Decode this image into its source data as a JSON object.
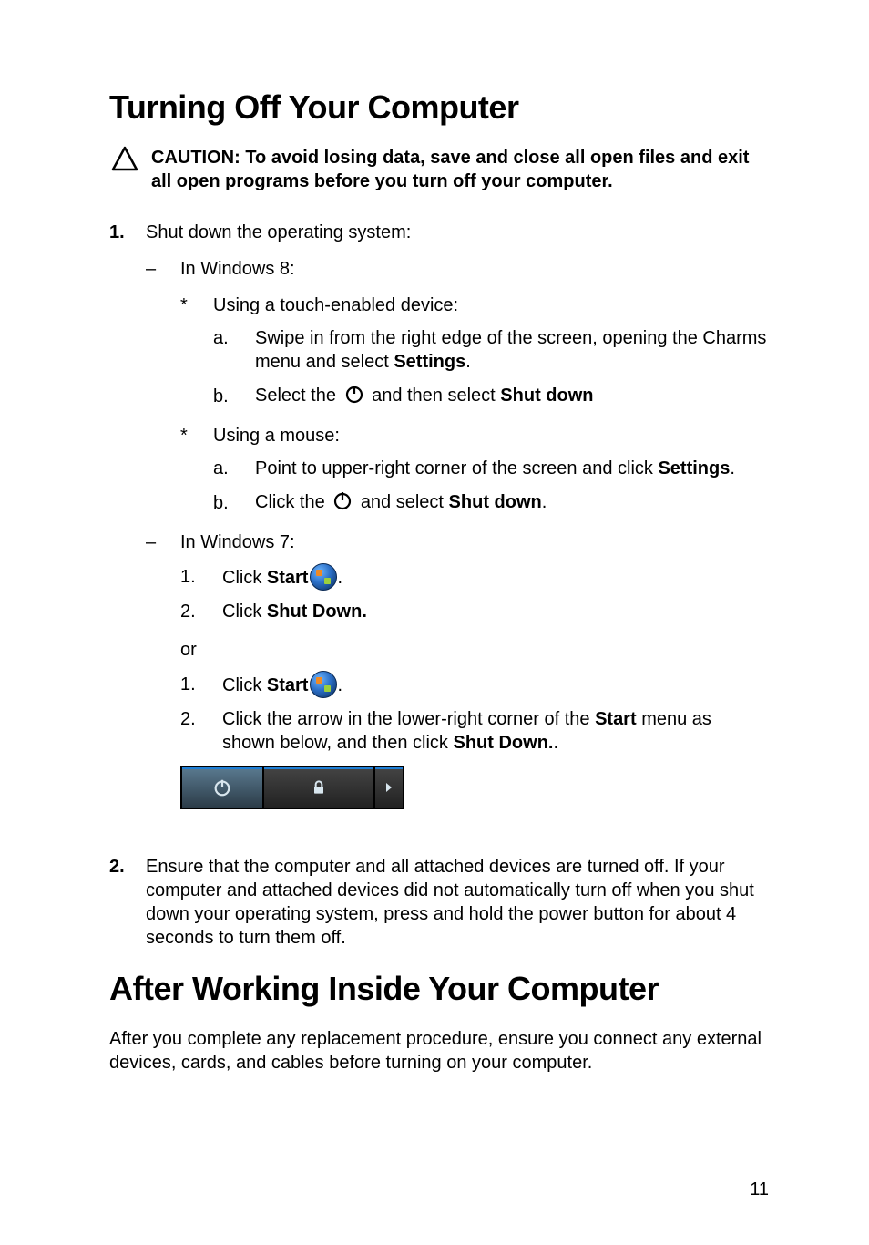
{
  "heading1": "Turning Off Your Computer",
  "caution": {
    "prefix": "CAUTION: To avoid losing data, save and close all open files and exit all open programs before you turn off your computer."
  },
  "step1": {
    "marker": "1.",
    "text": "Shut down the operating system:",
    "win8": {
      "label": "In Windows 8:",
      "touch": {
        "label": "Using a touch-enabled device:",
        "a_marker": "a.",
        "a_pre": "Swipe in from the right edge of the screen, opening the Charms menu and select ",
        "a_bold": "Settings",
        "a_post": ".",
        "b_marker": "b.",
        "b_pre": "Select the ",
        "b_mid": " and then select ",
        "b_bold": "Shut down"
      },
      "mouse": {
        "label": "Using a mouse:",
        "a_marker": "a.",
        "a_pre": "Point to upper-right corner of the screen and click ",
        "a_bold": "Settings",
        "a_post": ".",
        "b_marker": "b.",
        "b_pre": "Click the ",
        "b_mid": " and select ",
        "b_bold": "Shut down",
        "b_post": "."
      }
    },
    "win7": {
      "label": "In Windows 7:",
      "first": {
        "m1": "1.",
        "t1_pre": "Click ",
        "t1_bold": "Start",
        "t1_post": ".",
        "m2": "2.",
        "t2_pre": "Click ",
        "t2_bold": "Shut Down."
      },
      "or": "or",
      "second": {
        "m1": "1.",
        "t1_pre": "Click ",
        "t1_bold": "Start",
        "t1_post": ".",
        "m2": "2.",
        "t2_pre": "Click the arrow in the lower-right corner of the ",
        "t2_bold": "Start",
        "t2_mid": " menu as shown below, and then click ",
        "t2_bold2": "Shut Down.",
        "t2_post": "."
      }
    }
  },
  "step2": {
    "marker": "2.",
    "text": "Ensure that the computer and all attached devices are turned off. If your computer and attached devices did not automatically turn off when you shut down your operating system, press and hold the power button for about 4 seconds to turn them off."
  },
  "heading2": "After Working Inside Your Computer",
  "para2": "After you complete any replacement procedure, ensure you connect any external devices, cards, and cables before turning on your computer.",
  "pageNumber": "11",
  "dash": "–",
  "star": "*"
}
